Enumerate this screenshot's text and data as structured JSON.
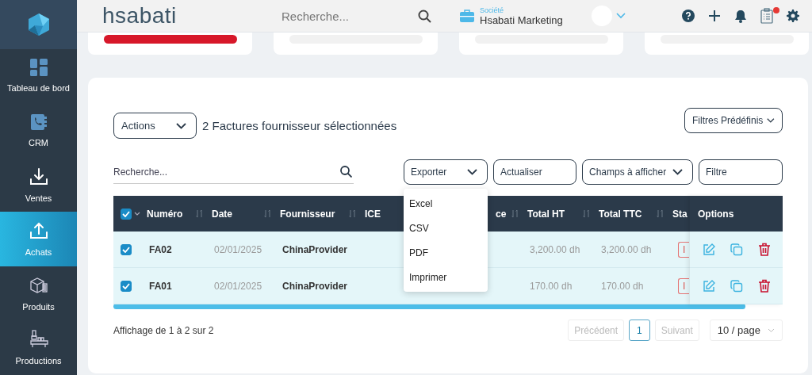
{
  "sidebar": {
    "items": [
      {
        "label": "Tableau de bord",
        "selected": false
      },
      {
        "label": "CRM",
        "selected": false
      },
      {
        "label": "Ventes",
        "selected": false
      },
      {
        "label": "Achats",
        "selected": true
      },
      {
        "label": "Produits",
        "selected": false
      },
      {
        "label": "Productions",
        "selected": false
      }
    ]
  },
  "header": {
    "logo": "hsabati",
    "search": {
      "placeholder": "Recherche..."
    },
    "company": {
      "label": "Société",
      "name": "Hsabati Marketing"
    },
    "has_notification": true
  },
  "toolbar": {
    "actions": "Actions",
    "selection_text": "2 Factures fournisseur sélectionnées",
    "preset_filters": "Filtres Prédéfinis",
    "search": {
      "placeholder": "Recherche..."
    },
    "buttons": [
      {
        "label": "Exporter",
        "kind": "dropdown",
        "menu": [
          "Excel",
          "CSV",
          "PDF",
          "Imprimer"
        ]
      },
      {
        "label": "Actualiser",
        "kind": "plain"
      },
      {
        "label": "Champs à afficher",
        "kind": "dropdown"
      },
      {
        "label": "Filtre",
        "kind": "plain"
      }
    ]
  },
  "table": {
    "all_selected": true,
    "columns": [
      {
        "label": "Numéro",
        "sort_icon": true
      },
      {
        "label": "Date",
        "sort_icon": true
      },
      {
        "label": "Fournisseur",
        "sort_icon": true
      },
      {
        "label": "ICE"
      },
      {
        "label": "ce",
        "sort_icon": true
      },
      {
        "label": "Total HT",
        "sort_icon": true
      },
      {
        "label": "Total TTC",
        "sort_icon": true
      },
      {
        "label": "Sta"
      }
    ],
    "options_header": "Options",
    "rows": [
      {
        "selected": true,
        "number": "FA02",
        "date": "02/01/2025",
        "supplier": "ChinaProvider",
        "total_ht": "3,200.00 dh",
        "total_ttc": "3,200.00 dh",
        "status": "I"
      },
      {
        "selected": true,
        "number": "FA01",
        "date": "02/01/2025",
        "supplier": "ChinaProvider",
        "total_ht": "170.00 dh",
        "total_ttc": "170.00 dh",
        "status": "I"
      }
    ]
  },
  "footer": {
    "summary": "Affichage de 1 à 2 sur 2",
    "previous": {
      "label": "Précédent",
      "disabled": true
    },
    "pages": [
      {
        "label": "1",
        "selected": true
      }
    ],
    "next": {
      "label": "Suivant",
      "disabled": true
    },
    "page_size": "10 / page"
  }
}
